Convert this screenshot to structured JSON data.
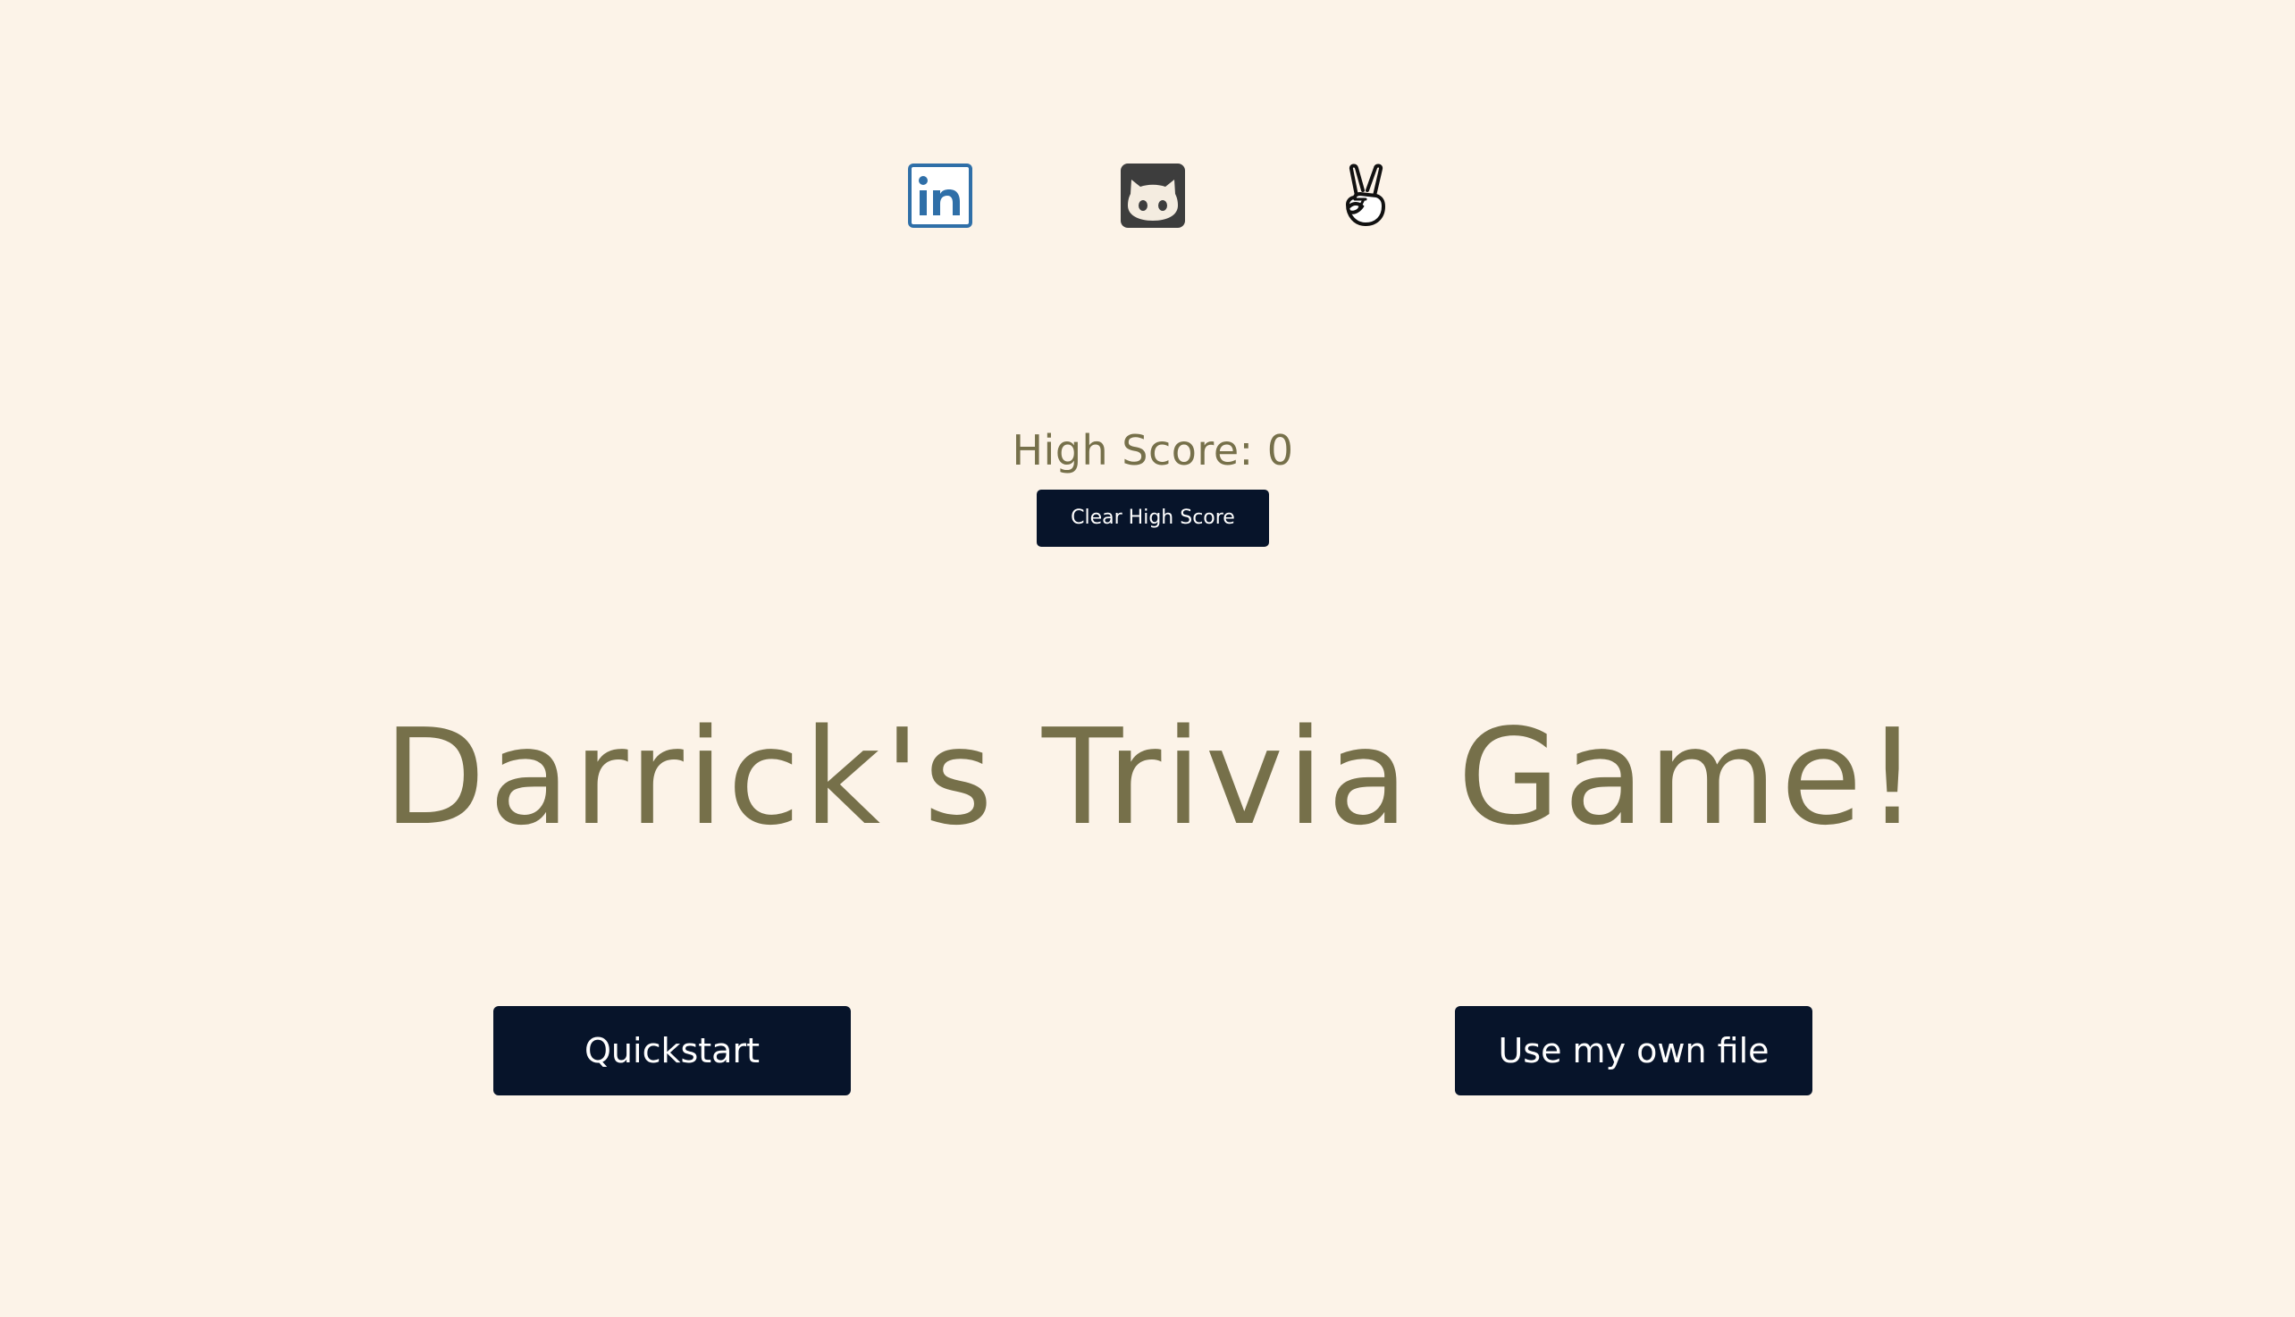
{
  "social": {
    "linkedin": {
      "icon": "linkedin-icon",
      "color": "#2f6fa8"
    },
    "github": {
      "icon": "github-icon",
      "color": "#3d3d3d"
    },
    "angellist": {
      "icon": "angellist-peace-icon",
      "color": "#111111"
    }
  },
  "scoreboard": {
    "high_score_text": "High Score: 0",
    "clear_button_label": "Clear High Score"
  },
  "title": "Darrick's Trivia Game!",
  "actions": {
    "quickstart_label": "Quickstart",
    "own_file_label": "Use my own file"
  },
  "colors": {
    "background": "#fcf3e8",
    "accent_text": "#76704a",
    "button_bg": "#07142a",
    "button_text": "#ffffff"
  }
}
